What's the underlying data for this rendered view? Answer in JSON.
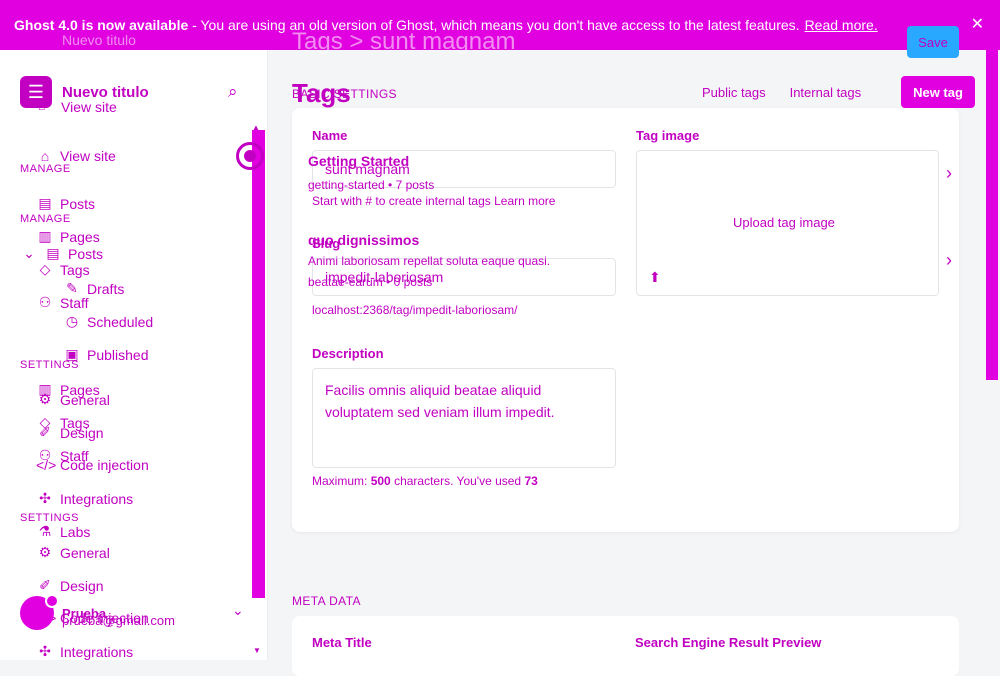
{
  "banner": {
    "bold": "Ghost 4.0 is now available",
    "text": " - You are using an old version of Ghost, which means you don't have access to the latest features.",
    "link": "Read more.",
    "close": "✕"
  },
  "ghost_overlay": {
    "breadcrumb": "Tags > sunt magnam",
    "brand_ghost": "Nuevo titulo"
  },
  "sidebar": {
    "brand_title": "Nuevo titulo",
    "view_site": "View site",
    "view_site_2": "View site",
    "manage_head": "MANAGE",
    "manage_head_2": "MANAGE",
    "settings_head": "SETTINGS",
    "settings_head_2": "SETTINGS",
    "items": [
      {
        "label": "Posts",
        "icon": "post-icon"
      },
      {
        "label": "Pages",
        "icon": "page-icon"
      },
      {
        "label": "Posts",
        "icon": "post-icon"
      },
      {
        "label": "Tags",
        "icon": "tag-icon"
      },
      {
        "label": "Drafts",
        "icon": "pencil-icon"
      },
      {
        "label": "Staff",
        "icon": "staff-icon"
      },
      {
        "label": "Scheduled",
        "icon": "clock-icon"
      },
      {
        "label": "Published",
        "icon": "published-icon"
      },
      {
        "label": "Pages",
        "icon": "page-icon"
      },
      {
        "label": "General",
        "icon": "gear-icon"
      },
      {
        "label": "Tags",
        "icon": "tag-icon"
      },
      {
        "label": "Design",
        "icon": "design-icon"
      },
      {
        "label": "Staff",
        "icon": "staff-icon"
      },
      {
        "label": "Code injection",
        "icon": "code-icon"
      },
      {
        "label": "Integrations",
        "icon": "integrations-icon"
      },
      {
        "label": "Labs",
        "icon": "labs-icon"
      },
      {
        "label": "General",
        "icon": "gear-icon"
      },
      {
        "label": "Design",
        "icon": "design-icon"
      },
      {
        "label": "Code injection",
        "icon": "code-icon"
      },
      {
        "label": "Integrations",
        "icon": "integrations-icon"
      }
    ],
    "user_name": "Prueba",
    "user_email": "prueba@gmail.com"
  },
  "main": {
    "page_title": "Tags",
    "section_basic": "BASIC SETTINGS",
    "tabs": [
      "Public tags",
      "Internal tags"
    ],
    "new_tag": "New tag",
    "save": "Save",
    "name_label": "Name",
    "name_value": "sunt magnam",
    "name_hint": "Start with # to create internal tags",
    "name_hint_link": "Learn more",
    "slug_label": "Slug",
    "slug_value": "impedit-laboriosam",
    "slug_url": "localhost:2368/tag/impedit-laboriosam/",
    "description_label": "Description",
    "description_value": "Facilis omnis aliquid beatae aliquid voluptatem sed veniam illum impedit.",
    "description_hint_prefix": "Maximum:",
    "description_max": "500",
    "description_hint_mid": "characters. You've used",
    "description_used": "73",
    "tag_image_label": "Tag image",
    "upload_text": "Upload tag image",
    "tag_list": [
      {
        "title": "Getting Started",
        "sub": "getting-started • 7 posts"
      },
      {
        "title": "quo dignissimos",
        "sub": "Animi laboriosam repellat soluta eaque quasi.",
        "sub2": "beatae-earum • 0 posts"
      }
    ],
    "meta_section": "META DATA",
    "meta_title_label": "Meta Title",
    "serp_label": "Search Engine Result Preview"
  },
  "colors": {
    "accent": "#e000e0",
    "accent_dark": "#c100c1"
  }
}
